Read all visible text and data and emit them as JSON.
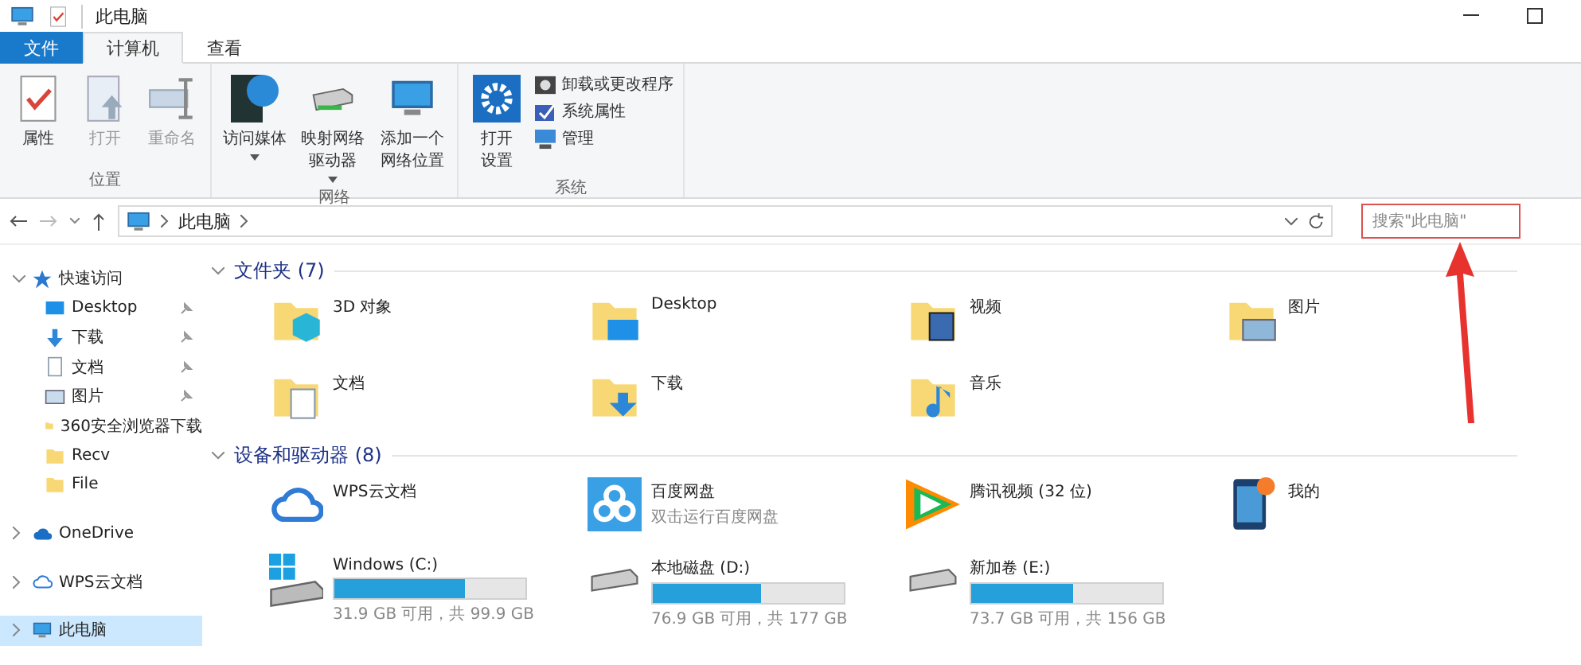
{
  "window": {
    "title": "此电脑"
  },
  "ribbon_tabs": [
    {
      "label": "文件",
      "kind": "file",
      "selected": false
    },
    {
      "label": "计算机",
      "kind": "tab",
      "selected": true
    },
    {
      "label": "查看",
      "kind": "tab",
      "selected": false
    }
  ],
  "ribbon_groups": [
    {
      "label": "位置",
      "buttons": [
        {
          "label": "属性",
          "disabled": false,
          "dropdown": false
        },
        {
          "label": "打开",
          "disabled": true,
          "dropdown": false
        },
        {
          "label": "重命名",
          "disabled": true,
          "dropdown": false
        }
      ]
    },
    {
      "label": "网络",
      "buttons": [
        {
          "label": "访问媒体",
          "disabled": false,
          "dropdown": true
        },
        {
          "label": "映射网络驱动器",
          "disabled": false,
          "dropdown": true
        },
        {
          "label": "添加一个网络位置",
          "disabled": false,
          "dropdown": false
        }
      ]
    },
    {
      "label": "系统",
      "buttons": [
        {
          "label": "打开设置",
          "disabled": false,
          "dropdown": false
        }
      ],
      "small": [
        {
          "label": "卸载或更改程序"
        },
        {
          "label": "系统属性"
        },
        {
          "label": "管理"
        }
      ]
    }
  ],
  "address": {
    "path": "此电脑"
  },
  "search": {
    "placeholder": "搜索\"此电脑\"",
    "highlighted": true
  },
  "sidebar": [
    {
      "label": "快速访问",
      "expanded": true,
      "selected": false,
      "children": [
        {
          "label": "Desktop",
          "pinned": true
        },
        {
          "label": "下载",
          "pinned": true
        },
        {
          "label": "文档",
          "pinned": true
        },
        {
          "label": "图片",
          "pinned": true
        },
        {
          "label": "360安全浏览器下载",
          "pinned": false
        },
        {
          "label": "Recv",
          "pinned": false
        },
        {
          "label": "File",
          "pinned": false
        }
      ]
    },
    {
      "label": "OneDrive",
      "expanded": false,
      "selected": false
    },
    {
      "label": "WPS云文档",
      "expanded": false,
      "selected": false
    },
    {
      "label": "此电脑",
      "expanded": false,
      "selected": true
    }
  ],
  "sections": [
    {
      "title": "文件夹 (7)",
      "expanded": true,
      "items": [
        {
          "name": "3D 对象"
        },
        {
          "name": "Desktop"
        },
        {
          "name": "视频"
        },
        {
          "name": "图片"
        },
        {
          "name": "文档"
        },
        {
          "name": "下载"
        },
        {
          "name": "音乐"
        }
      ]
    },
    {
      "title": "设备和驱动器 (8)",
      "expanded": true,
      "items": [
        {
          "name": "WPS云文档"
        },
        {
          "name": "百度网盘",
          "subtitle": "双击运行百度网盘"
        },
        {
          "name": "腾讯视频 (32 位)"
        },
        {
          "name": "我的"
        },
        {
          "name": "Windows (C:)",
          "level": 0.68,
          "info": "31.9 GB 可用，共 99.9 GB"
        },
        {
          "name": "本地磁盘 (D:)",
          "level": 0.57,
          "info": "76.9 GB 可用，共 177 GB"
        },
        {
          "name": "新加卷 (E:)",
          "level": 0.53,
          "info": "73.7 GB 可用，共 156 GB"
        }
      ]
    }
  ],
  "annotation": {
    "kind": "arrow"
  }
}
